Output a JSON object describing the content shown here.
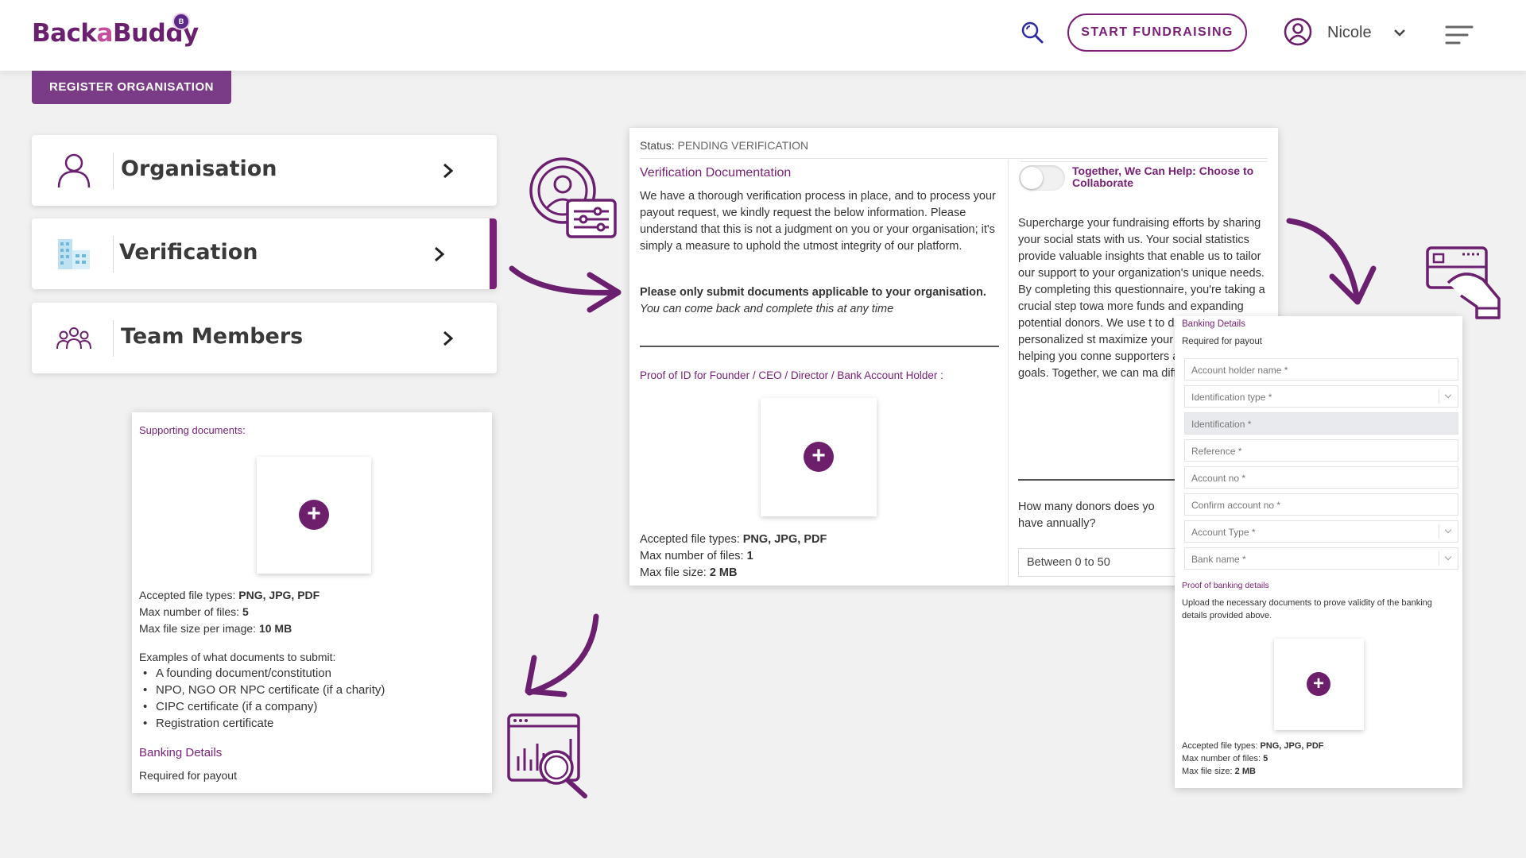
{
  "header": {
    "logo_text_1": "Back",
    "logo_text_2": "a",
    "logo_text_3": "Buddy",
    "logo_badge": "B",
    "start_fundraising": "START FUNDRAISING",
    "user_name": "Nicole"
  },
  "register_button": "REGISTER ORGANISATION",
  "menu": [
    {
      "label": "Organisation"
    },
    {
      "label": "Verification"
    },
    {
      "label": "Team Members"
    }
  ],
  "supporting": {
    "title": "Supporting documents:",
    "accepted_prefix": "Accepted file types: ",
    "accepted_value": "PNG, JPG, PDF",
    "max_files_prefix": "Max number of files: ",
    "max_files_value": "5",
    "max_size_prefix": "Max file size per image: ",
    "max_size_value": "10 MB",
    "examples_title": "Examples of what documents to submit:",
    "examples": [
      "A founding document/constitution",
      "NPO, NGO OR NPC certificate (if a charity)",
      "CIPC certificate (if a company)",
      "Registration certificate"
    ],
    "banking_title": "Banking Details",
    "banking_sub": "Required for payout"
  },
  "verification": {
    "status_label": "Status:",
    "status_value": "PENDING VERIFICATION",
    "doc_title": "Verification Documentation",
    "intro": "We have a thorough verification process in place, and to process your payout request, we kindly request the below information. Please understand that this is not a judgment on you or your organisation; it's simply a measure to uphold the utmost integrity of our platform.",
    "note_bold": "Please only submit documents applicable to your organisation.",
    "note_italic": "You can come back and complete this at any time",
    "proof_title": "Proof of ID for Founder / CEO / Director / Bank Account Holder :",
    "accepted_prefix": "Accepted file types: ",
    "accepted_value": "PNG, JPG, PDF",
    "max_files_prefix": "Max number of files: ",
    "max_files_value": "1",
    "max_size_prefix": "Max file size: ",
    "max_size_value": "2 MB",
    "collab_title": "Together, We Can Help: Choose to Collaborate",
    "collab_text": "Supercharge your fundraising efforts by sharing your social stats with us. Your social statistics provide valuable insights that enable us to tailor our support to your organization's unique needs. By completing this questionnaire, you're taking a crucial step towa more funds and expanding potential donors. We use t to develop personalized st maximize your impact in t sphere, helping you conne supporters and achieve yo goals. Together, we can ma difference.",
    "donors_question": "How many donors does yo have annually?",
    "donors_value": "Between 0 to 50"
  },
  "banking": {
    "title": "Banking Details",
    "subtitle": "Required for payout",
    "fields": [
      "Account holder name *",
      "Identification type *",
      "Identification *",
      "Reference *",
      "Account no *",
      "Confirm account no *",
      "Account Type *",
      "Bank name *"
    ],
    "proof_title": "Proof of banking details",
    "proof_text": "Upload the necessary documents to prove validity of the banking details provided above.",
    "accepted_prefix": "Accepted file types: ",
    "accepted_value": "PNG, JPG, PDF",
    "max_files_prefix": "Max number of files: ",
    "max_files_value": "5",
    "max_size_prefix": "Max file size: ",
    "max_size_value": "2 MB"
  },
  "colors": {
    "brand_purple": "#7a1f78",
    "plus_purple": "#6d1f6b",
    "register_bg": "#7a3c87"
  }
}
